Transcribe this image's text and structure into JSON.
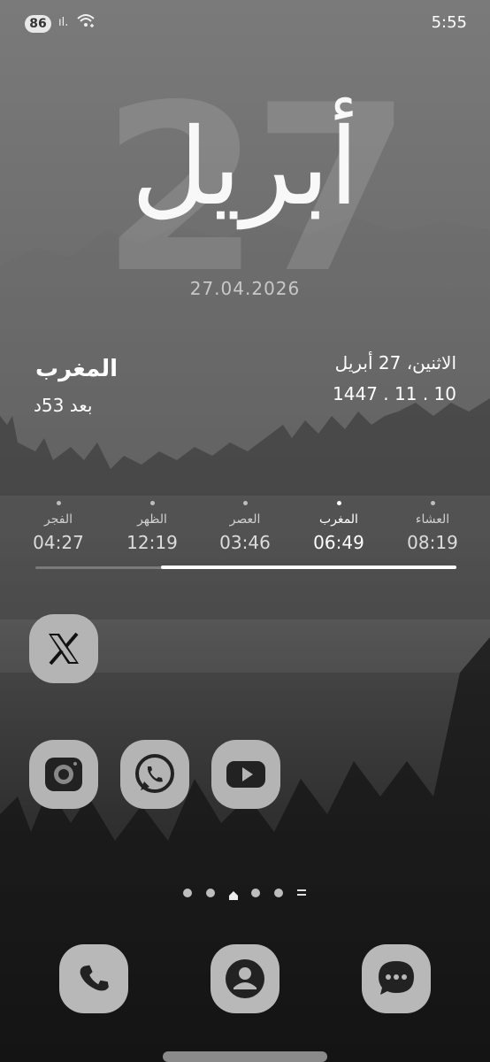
{
  "status": {
    "battery": "86",
    "time": "5:55",
    "battery_icon": "battery-pill",
    "signal_icon": "signal-icon",
    "wifi_icon": "wifi-icon"
  },
  "widget": {
    "big_day": "27",
    "month_arabic": "أبريل",
    "date_numeric": "27.04.2026",
    "next_prayer_name": "المغرب",
    "next_prayer_remaining": "بعد 53د",
    "gregorian_date": "الاثنين، 27 أبريل",
    "hijri_date": "1447 . 11 . 10",
    "prayers": [
      {
        "name": "الفجر",
        "time": "04:27",
        "active": false
      },
      {
        "name": "الظهر",
        "time": "12:19",
        "active": false
      },
      {
        "name": "العصر",
        "time": "03:46",
        "active": false
      },
      {
        "name": "المغرب",
        "time": "06:49",
        "active": true
      },
      {
        "name": "العشاء",
        "time": "08:19",
        "active": false
      }
    ],
    "day_progress": 0.7
  },
  "apps": {
    "row1": [
      {
        "name": "X",
        "icon": "x-icon"
      }
    ],
    "row2": [
      {
        "name": "Camera",
        "icon": "camera-icon"
      },
      {
        "name": "WhatsApp",
        "icon": "whatsapp-icon"
      },
      {
        "name": "YouTube",
        "icon": "youtube-icon"
      }
    ]
  },
  "dock": [
    {
      "name": "Phone",
      "icon": "phone-icon"
    },
    {
      "name": "Contacts",
      "icon": "contacts-icon"
    },
    {
      "name": "Messages",
      "icon": "messages-icon"
    }
  ],
  "pages": {
    "count": 5,
    "current": 2
  }
}
